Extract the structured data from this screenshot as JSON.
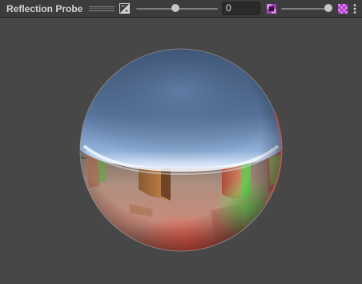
{
  "window": {
    "title": "Reflection Probe"
  },
  "toolbar": {
    "exposure_value": "0",
    "exposure_icon": "exposure-icon",
    "mip_low_icon": "mip-low-icon",
    "mip_high_icon": "mip-high-icon",
    "menu_icon": "kebab-menu-icon",
    "exposure_slider_level": 0.5,
    "mip_slider_level": 1.0
  },
  "colors": {
    "toolbar_bg": "#3c3c3c",
    "panel_bg": "#474747",
    "field_bg": "#2a2a2a",
    "accent_icon": "#c45bd6"
  }
}
